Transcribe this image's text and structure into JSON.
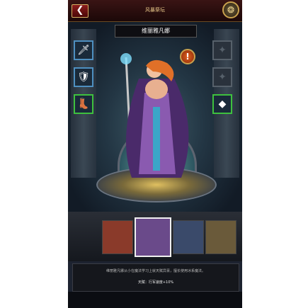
{
  "header": {
    "title": "风暴祭坛",
    "back_symbol": "❮",
    "menu_symbol": "❂"
  },
  "hero": {
    "name": "维丽雅凡娜",
    "alert_symbol": "!"
  },
  "equipment": {
    "left_slots": [
      {
        "icon": "sword-icon",
        "symbol": "🗡"
      },
      {
        "icon": "armor-icon",
        "symbol": "🛡"
      },
      {
        "icon": "boots-icon",
        "symbol": "👢"
      }
    ],
    "right_slots": [
      {
        "icon": "empty-slot-icon",
        "symbol": "✦"
      },
      {
        "icon": "empty-slot-icon",
        "symbol": "✦"
      },
      {
        "icon": "orb-icon",
        "symbol": "◆"
      }
    ]
  },
  "description": {
    "text": "维丽雅凡娜从小在魔法学习上就天赋异禀，擅长使用冰系魔法。",
    "talent": "天赋：行军速度+10%"
  },
  "portraits": [
    {
      "name": "witch-hero",
      "color": "#8a3a2a"
    },
    {
      "name": "mage-hero",
      "color": "#6a4a8a",
      "selected": true
    },
    {
      "name": "knight-hero",
      "color": "#3a4a6a"
    },
    {
      "name": "dwarf-hero",
      "color": "#6a5a3a"
    }
  ],
  "colors": {
    "accent_gold": "#c9a24e",
    "slot_blue": "#4e8fc0",
    "slot_green": "#3ec03e"
  }
}
